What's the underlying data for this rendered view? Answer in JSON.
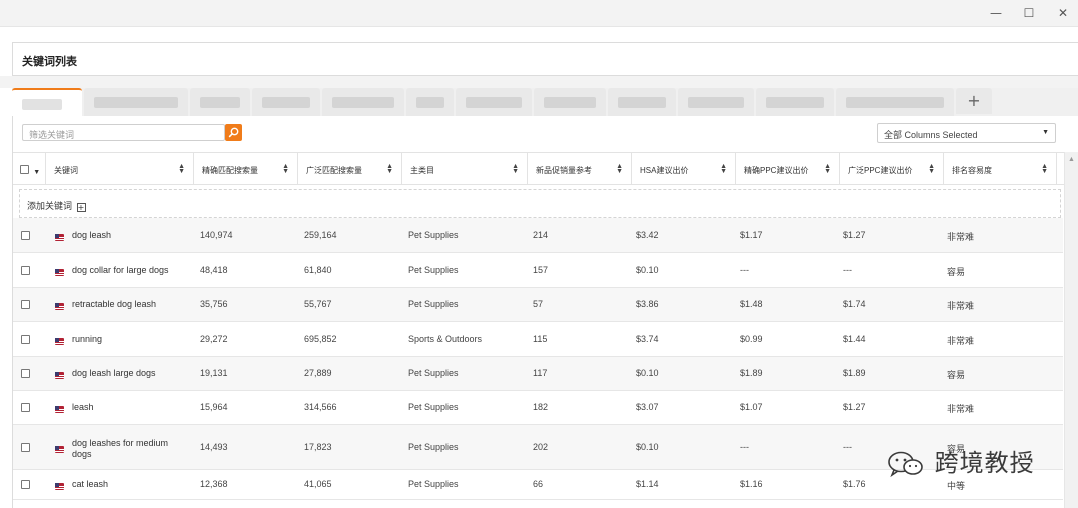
{
  "window": {
    "minimize_glyph": "—",
    "maximize_glyph": "☐",
    "close_glyph": "✕"
  },
  "panel": {
    "title": "关键词列表"
  },
  "tabs": {
    "add_glyph": "+"
  },
  "toolbar": {
    "search_placeholder": "筛选关键词",
    "search_icon": "search-icon",
    "column_select_value": "全部 Columns Selected"
  },
  "table": {
    "columns": [
      "关键词",
      "精确匹配搜索量",
      "广泛匹配搜索量",
      "主类目",
      "新品促销量参考",
      "HSA建议出价",
      "精确PPC建议出价",
      "广泛PPC建议出价",
      "排名容易度"
    ],
    "add_keyword_label": "添加关键词",
    "rows": [
      {
        "keyword": "dog leash",
        "exact": "140,974",
        "broad": "259,164",
        "category": "Pet Supplies",
        "new_sales": "214",
        "hsa": "$3.42",
        "exact_ppc": "$1.17",
        "broad_ppc": "$1.27",
        "ease": "非常难"
      },
      {
        "keyword": "dog collar for large dogs",
        "exact": "48,418",
        "broad": "61,840",
        "category": "Pet Supplies",
        "new_sales": "157",
        "hsa": "$0.10",
        "exact_ppc": "---",
        "broad_ppc": "---",
        "ease": "容易"
      },
      {
        "keyword": "retractable dog leash",
        "exact": "35,756",
        "broad": "55,767",
        "category": "Pet Supplies",
        "new_sales": "57",
        "hsa": "$3.86",
        "exact_ppc": "$1.48",
        "broad_ppc": "$1.74",
        "ease": "非常难"
      },
      {
        "keyword": "running",
        "exact": "29,272",
        "broad": "695,852",
        "category": "Sports & Outdoors",
        "new_sales": "115",
        "hsa": "$3.74",
        "exact_ppc": "$0.99",
        "broad_ppc": "$1.44",
        "ease": "非常难"
      },
      {
        "keyword": "dog leash large dogs",
        "exact": "19,131",
        "broad": "27,889",
        "category": "Pet Supplies",
        "new_sales": "117",
        "hsa": "$0.10",
        "exact_ppc": "$1.89",
        "broad_ppc": "$1.89",
        "ease": "容易"
      },
      {
        "keyword": "leash",
        "exact": "15,964",
        "broad": "314,566",
        "category": "Pet Supplies",
        "new_sales": "182",
        "hsa": "$3.07",
        "exact_ppc": "$1.07",
        "broad_ppc": "$1.27",
        "ease": "非常难"
      },
      {
        "keyword": "dog leashes for medium dogs",
        "exact": "14,493",
        "broad": "17,823",
        "category": "Pet Supplies",
        "new_sales": "202",
        "hsa": "$0.10",
        "exact_ppc": "---",
        "broad_ppc": "---",
        "ease": "容易"
      },
      {
        "keyword": "cat leash",
        "exact": "12,368",
        "broad": "41,065",
        "category": "Pet Supplies",
        "new_sales": "66",
        "hsa": "$1.14",
        "exact_ppc": "$1.16",
        "broad_ppc": "$1.76",
        "ease": "中等"
      }
    ]
  },
  "watermark": {
    "text": "跨境教授"
  },
  "colors": {
    "accent": "#f07c1a",
    "flag_red": "#b22234",
    "flag_blue": "#3c3b6e"
  }
}
